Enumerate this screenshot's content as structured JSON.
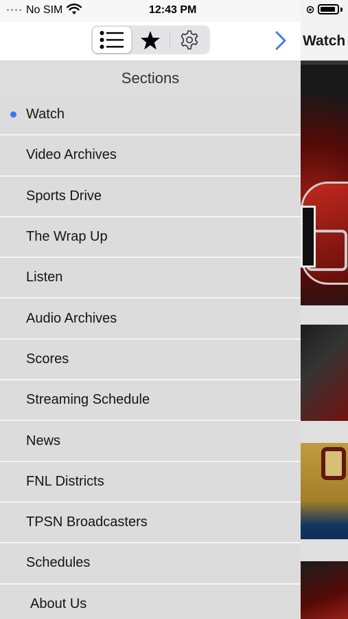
{
  "status_bar": {
    "carrier": "No SIM",
    "time": "12:43 PM"
  },
  "toolbar": {
    "segments": [
      {
        "icon": "list-icon",
        "selected": true
      },
      {
        "icon": "star-icon",
        "selected": false
      },
      {
        "icon": "gear-icon",
        "selected": false
      }
    ],
    "forward_icon": "chevron-right-icon",
    "accent_color": "#3478f6"
  },
  "drawer": {
    "header": "Sections",
    "items": [
      {
        "label": "Watch",
        "active": true
      },
      {
        "label": "Video Archives"
      },
      {
        "label": "Sports Drive"
      },
      {
        "label": "The Wrap Up"
      },
      {
        "label": "Listen"
      },
      {
        "label": "Audio Archives"
      },
      {
        "label": "Scores"
      },
      {
        "label": "Streaming Schedule"
      },
      {
        "label": "News"
      },
      {
        "label": "FNL Districts"
      },
      {
        "label": "TPSN Broadcasters"
      },
      {
        "label": "Schedules"
      },
      {
        "label": "About Us"
      }
    ]
  },
  "main": {
    "title": "Watch"
  }
}
